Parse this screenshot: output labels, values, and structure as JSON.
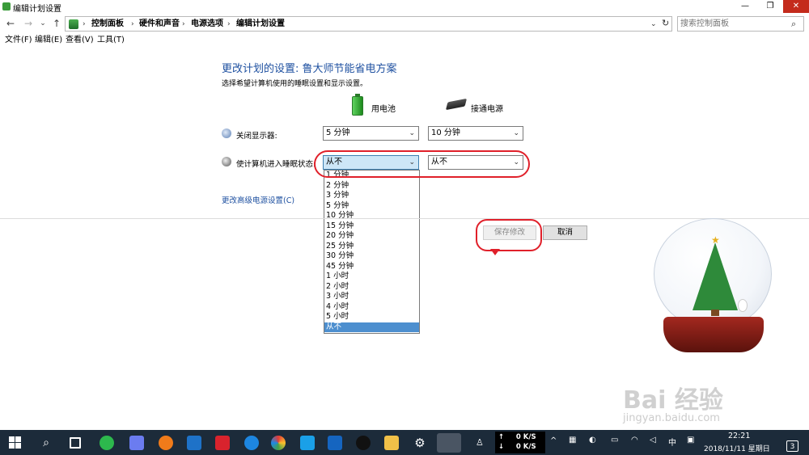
{
  "window": {
    "title": "编辑计划设置",
    "minimize": "—",
    "maximize": "❐",
    "close": "✕"
  },
  "nav": {
    "back": "←",
    "forward": "→",
    "recent": "⌄",
    "up": "↑",
    "breadcrumbs": [
      "控制面板",
      "硬件和声音",
      "电源选项",
      "编辑计划设置"
    ],
    "separator": "›",
    "dropdown": "⌄",
    "refresh": "↻"
  },
  "search": {
    "placeholder": "搜索控制面板",
    "icon": "⌕"
  },
  "menu": {
    "items": [
      "文件(F)",
      "编辑(E)",
      "查看(V)",
      "工具(T)"
    ]
  },
  "plan": {
    "title": "更改计划的设置: 鲁大师节能省电方案",
    "subtitle": "选择希望计算机使用的睡眠设置和显示设置。",
    "battery_label": "用电池",
    "plugged_label": "接通电源",
    "display_label": "关闭显示器:",
    "display_battery": "5 分钟",
    "display_plugged": "10 分钟",
    "sleep_label": "使计算机进入睡眠状态:",
    "sleep_battery": "从不",
    "sleep_plugged": "从不",
    "arrow": "⌄",
    "advanced_link": "更改高级电源设置(C)"
  },
  "dropdown_options": [
    "1 分钟",
    "2 分钟",
    "3 分钟",
    "5 分钟",
    "10 分钟",
    "15 分钟",
    "20 分钟",
    "25 分钟",
    "30 分钟",
    "45 分钟",
    "1 小时",
    "2 小时",
    "3 小时",
    "4 小时",
    "5 小时",
    "从不"
  ],
  "dropdown_selected_index": 15,
  "buttons": {
    "save": "保存修改",
    "cancel": "取消"
  },
  "watermark": {
    "main": "Bai 经验",
    "sub": "jingyan.baidu.com"
  },
  "taskbar": {
    "net_up": "↑     0 K/S",
    "net_down": "↓     0 K/S",
    "tray_ime": "中",
    "clock_time": "22:21",
    "clock_date": "2018/11/11 星期日",
    "notifications": "3"
  },
  "colors": {
    "link": "#1e50a0",
    "annotation": "#e0202a",
    "taskbar": "#1c2b3a",
    "selected": "#4d8fcf"
  }
}
